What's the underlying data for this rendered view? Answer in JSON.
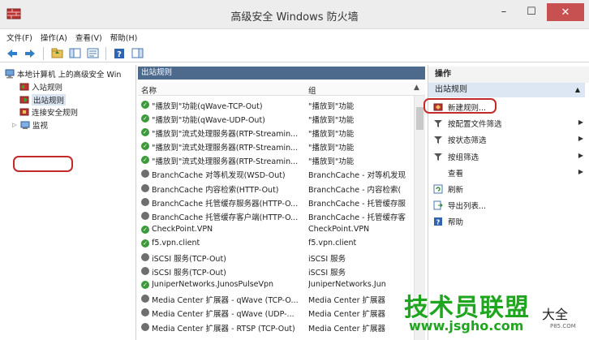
{
  "window": {
    "title": "高级安全 Windows 防火墙",
    "minimize": "–",
    "maximize": "☐",
    "close": "✕"
  },
  "menu": [
    {
      "label": "文件(F)"
    },
    {
      "label": "操作(A)"
    },
    {
      "label": "查看(V)"
    },
    {
      "label": "帮助(H)"
    }
  ],
  "toolbar": {
    "icons": [
      "back-arrow-icon",
      "forward-arrow-icon",
      "up-folder-icon",
      "show-hide-tree-icon",
      "properties-icon",
      "help-icon",
      "show-pane-icon"
    ]
  },
  "tree": {
    "root": "本地计算机 上的高级安全 Win",
    "inbound": "入站规则",
    "outbound": "出站规则",
    "security": "连接安全规则",
    "monitor": "监视"
  },
  "main": {
    "pane_title": "出站规则",
    "columns": {
      "name": "名称",
      "group": "组"
    },
    "rows": [
      {
        "status": "enabled",
        "name": "\"播放到\"功能(qWave-TCP-Out)",
        "group": "\"播放到\"功能"
      },
      {
        "status": "enabled",
        "name": "\"播放到\"功能(qWave-UDP-Out)",
        "group": "\"播放到\"功能"
      },
      {
        "status": "enabled",
        "name": "\"播放到\"流式处理服务器(RTP-Streamin...",
        "group": "\"播放到\"功能"
      },
      {
        "status": "enabled",
        "name": "\"播放到\"流式处理服务器(RTP-Streamin...",
        "group": "\"播放到\"功能"
      },
      {
        "status": "enabled",
        "name": "\"播放到\"流式处理服务器(RTP-Streamin...",
        "group": "\"播放到\"功能"
      },
      {
        "status": "disabled",
        "name": "BranchCache 对等机发现(WSD-Out)",
        "group": "BranchCache - 对等机发现"
      },
      {
        "status": "disabled",
        "name": "BranchCache 内容检索(HTTP-Out)",
        "group": "BranchCache - 内容检索("
      },
      {
        "status": "disabled",
        "name": "BranchCache 托管缓存服务器(HTTP-O...",
        "group": "BranchCache - 托管缓存服"
      },
      {
        "status": "disabled",
        "name": "BranchCache 托管缓存客户端(HTTP-O...",
        "group": "BranchCache - 托管缓存客"
      },
      {
        "status": "enabled",
        "name": "CheckPoint.VPN",
        "group": "CheckPoint.VPN"
      },
      {
        "status": "enabled",
        "name": "f5.vpn.client",
        "group": "f5.vpn.client"
      },
      {
        "status": "disabled",
        "name": "iSCSI 服务(TCP-Out)",
        "group": "iSCSI 服务"
      },
      {
        "status": "disabled",
        "name": "iSCSI 服务(TCP-Out)",
        "group": "iSCSI 服务"
      },
      {
        "status": "enabled",
        "name": "JuniperNetworks.JunosPulseVpn",
        "group": "JuniperNetworks.Jun"
      },
      {
        "status": "disabled",
        "name": "Media Center 扩展器 - qWave (TCP-O...",
        "group": "Media Center 扩展器"
      },
      {
        "status": "disabled",
        "name": "Media Center 扩展器 - qWave (UDP-...",
        "group": "Media Center 扩展器"
      },
      {
        "status": "disabled",
        "name": "Media Center 扩展器 - RTSP (TCP-Out)",
        "group": "Media Center 扩展器"
      }
    ]
  },
  "actions": {
    "title": "操作",
    "section": "出站规则",
    "items": [
      {
        "label": "新建规则...",
        "icon": "new-rule-icon",
        "submenu": false
      },
      {
        "label": "按配置文件筛选",
        "icon": "filter-icon",
        "submenu": true
      },
      {
        "label": "按状态筛选",
        "icon": "filter-icon",
        "submenu": true
      },
      {
        "label": "按组筛选",
        "icon": "filter-icon",
        "submenu": true
      },
      {
        "label": "查看",
        "icon": "",
        "submenu": true
      },
      {
        "label": "刷新",
        "icon": "refresh-icon",
        "submenu": false
      },
      {
        "label": "导出列表...",
        "icon": "export-icon",
        "submenu": false
      },
      {
        "label": "帮助",
        "icon": "help-icon",
        "submenu": false
      }
    ]
  },
  "watermark": {
    "main": "技术员联盟",
    "sub": "www.jsgho.com",
    "side": "大全",
    "small": "P85.COM"
  },
  "colors": {
    "enabled": "#3c9a3a",
    "disabled": "#6e6e6e",
    "highlight": "#c32b2b",
    "pane_header": "#4d6a8c"
  }
}
